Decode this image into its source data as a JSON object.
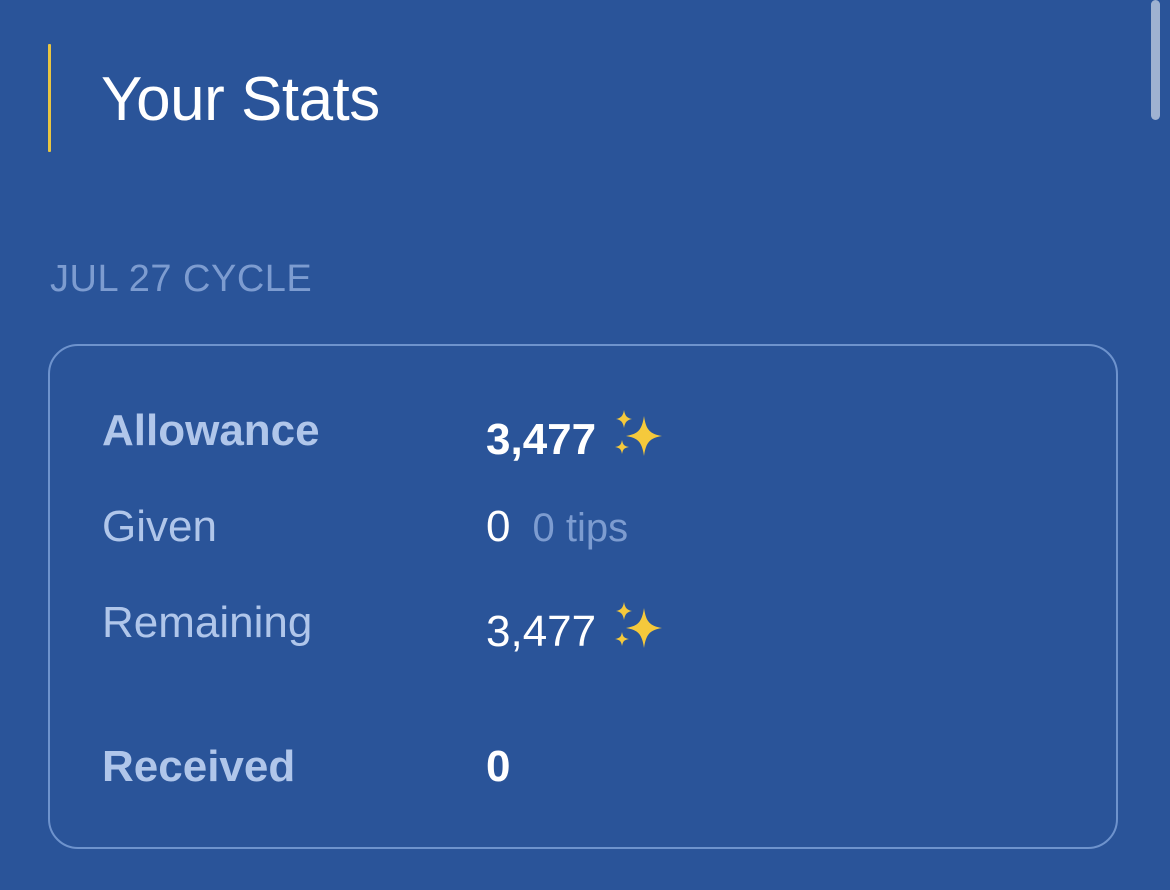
{
  "header": {
    "title": "Your Stats"
  },
  "cycle": {
    "label": "JUL 27 CYCLE"
  },
  "stats": {
    "allowance": {
      "label": "Allowance",
      "value": "3,477",
      "icon": "sparkles-icon"
    },
    "given": {
      "label": "Given",
      "value": "0",
      "note": "0 tips"
    },
    "remaining": {
      "label": "Remaining",
      "value": "3,477",
      "icon": "sparkles-icon"
    },
    "received": {
      "label": "Received",
      "value": "0"
    }
  },
  "colors": {
    "background": "#2a5499",
    "accent": "#e8c542",
    "muted_text": "#7d9cd0",
    "label_text": "#b0c6ea",
    "card_border": "#6e93cd"
  }
}
